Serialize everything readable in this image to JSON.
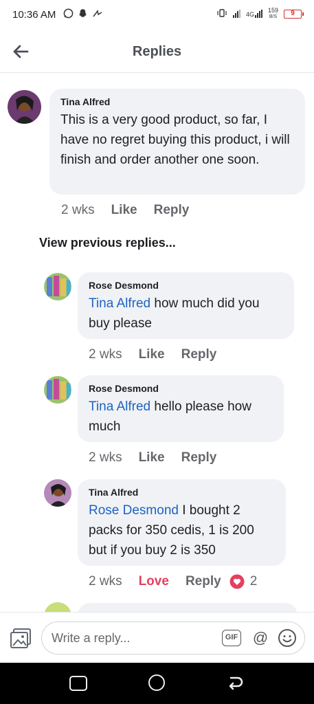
{
  "status_bar": {
    "time": "10:36 AM",
    "net_label_top": "4G",
    "data_speed_top": "159",
    "data_speed_unit": "B/S",
    "battery": "9",
    "icons": [
      "whatsapp-icon",
      "snapchat-icon",
      "signal-icon"
    ]
  },
  "header": {
    "title": "Replies",
    "back_icon": "arrow-left-icon"
  },
  "comments": [
    {
      "author": "Tina Alfred",
      "mention": "",
      "text": "This is a very good product, so far, I have no regret buying this product, i will finish and order another one soon.",
      "time": "2 wks",
      "react_label": "Like",
      "reply_label": "Reply"
    },
    {
      "author": "Rose Desmond",
      "mention": "Tina Alfred",
      "text": " how much did you buy please",
      "time": "2 wks",
      "react_label": "Like",
      "reply_label": "Reply"
    },
    {
      "author": "Rose Desmond",
      "mention": "Tina Alfred",
      "text": " hello please how much",
      "time": "2 wks",
      "react_label": "Like",
      "reply_label": "Reply"
    },
    {
      "author": "Tina Alfred",
      "mention": "Rose Desmond",
      "text": "  I bought 2 packs for 350 cedis, 1 is 200 but if you buy 2 is 350",
      "time": "2 wks",
      "react_label": "Love",
      "reply_label": "Reply",
      "reaction_count": "2"
    }
  ],
  "view_previous": "View previous replies...",
  "composer": {
    "placeholder": "Write a reply...",
    "gif_label": "GIF",
    "at_label": "@"
  },
  "colors": {
    "mention": "#1e63c4",
    "love": "#e4405f",
    "bubble": "#f0f2f5"
  }
}
